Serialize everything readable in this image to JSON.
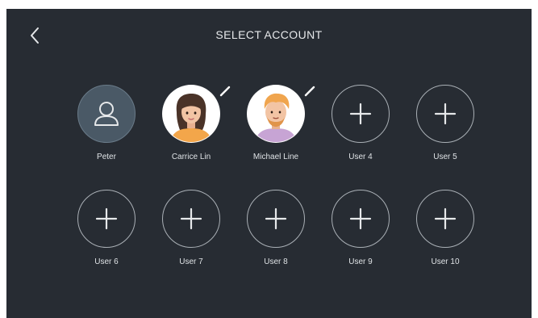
{
  "header": {
    "title": "SELECT ACCOUNT"
  },
  "accounts": [
    {
      "name": "Peter",
      "type": "user"
    },
    {
      "name": "Carrice Lin",
      "type": "photo"
    },
    {
      "name": "Michael Line",
      "type": "photo"
    },
    {
      "name": "User 4",
      "type": "empty"
    },
    {
      "name": "User 5",
      "type": "empty"
    },
    {
      "name": "User 6",
      "type": "empty"
    },
    {
      "name": "User 7",
      "type": "empty"
    },
    {
      "name": "User 8",
      "type": "empty"
    },
    {
      "name": "User 9",
      "type": "empty"
    },
    {
      "name": "User 10",
      "type": "empty"
    }
  ],
  "colors": {
    "background": "#272c33",
    "text": "#e6e8ea",
    "ring": "#aab0b6"
  }
}
